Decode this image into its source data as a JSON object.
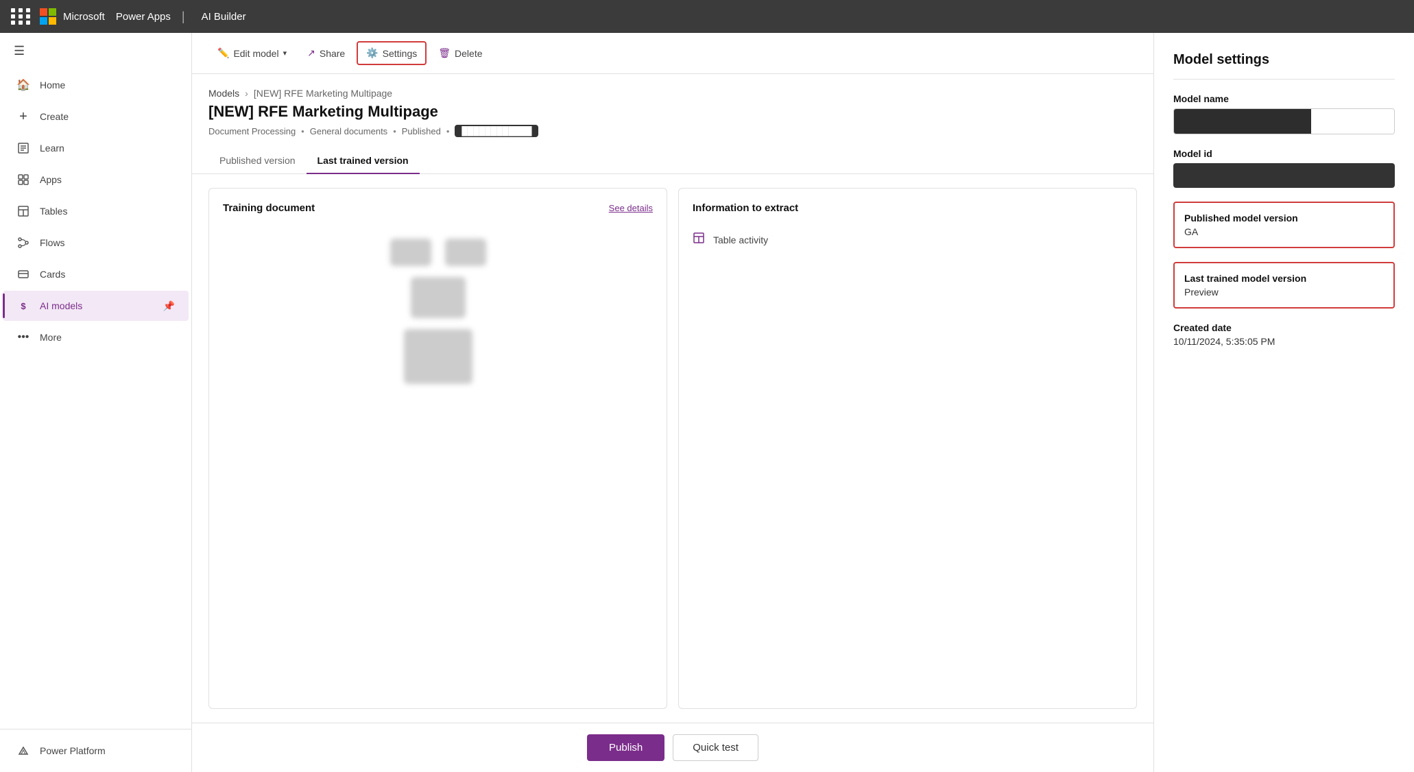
{
  "topbar": {
    "app_name": "Power Apps",
    "separator": "|",
    "product_name": "AI Builder"
  },
  "sidebar": {
    "items": [
      {
        "id": "home",
        "label": "Home",
        "icon": "⌂"
      },
      {
        "id": "create",
        "label": "Create",
        "icon": "+"
      },
      {
        "id": "learn",
        "label": "Learn",
        "icon": "◫"
      },
      {
        "id": "apps",
        "label": "Apps",
        "icon": "⊞"
      },
      {
        "id": "tables",
        "label": "Tables",
        "icon": "⊞"
      },
      {
        "id": "flows",
        "label": "Flows",
        "icon": "⌥"
      },
      {
        "id": "cards",
        "label": "Cards",
        "icon": "⊟"
      },
      {
        "id": "ai_models",
        "label": "AI models",
        "icon": "$",
        "active": true
      },
      {
        "id": "more",
        "label": "More",
        "icon": "…"
      }
    ],
    "bottom_item": {
      "label": "Power Platform",
      "icon": "⊸"
    }
  },
  "toolbar": {
    "edit_model_label": "Edit model",
    "share_label": "Share",
    "settings_label": "Settings",
    "delete_label": "Delete"
  },
  "breadcrumb": {
    "parent": "Models",
    "current": "[NEW] RFE Marketing Multipage"
  },
  "page": {
    "title": "[NEW] RFE Marketing Multipage",
    "subtitle_type": "Document Processing",
    "subtitle_category": "General documents",
    "subtitle_status": "Published",
    "subtitle_badge": "████████████"
  },
  "tabs": [
    {
      "id": "published_version",
      "label": "Published version"
    },
    {
      "id": "last_trained_version",
      "label": "Last trained version",
      "active": true
    }
  ],
  "cards": {
    "training_doc": {
      "title": "Training document",
      "link": "See details"
    },
    "info_to_extract": {
      "title": "Information to extract",
      "table_activity": "Table activity"
    }
  },
  "actions": {
    "publish_label": "Publish",
    "quick_test_label": "Quick test"
  },
  "settings_panel": {
    "title": "Model settings",
    "model_name_label": "Model name",
    "model_id_label": "Model id",
    "published_version_label": "Published model version",
    "published_version_value": "GA",
    "last_trained_version_label": "Last trained model version",
    "last_trained_version_value": "Preview",
    "created_date_label": "Created date",
    "created_date_value": "10/11/2024, 5:35:05 PM"
  }
}
